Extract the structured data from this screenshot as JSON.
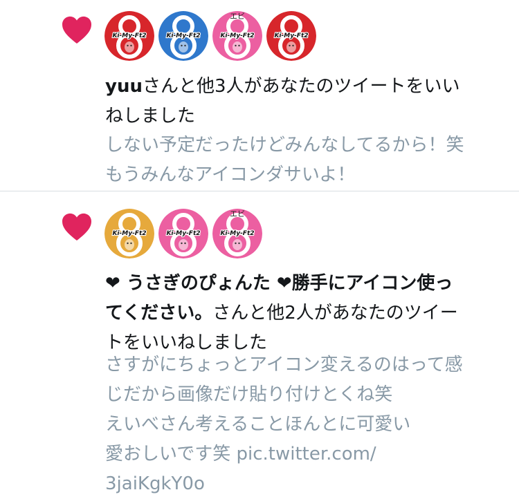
{
  "colors": {
    "heart": "#e0245e",
    "red": "#d7262b",
    "blue": "#2f78cc",
    "pink": "#ec5fa1",
    "yellow": "#e6a93c",
    "divider": "#d8dde1",
    "name_text": "#14171a",
    "preview_text": "#8899a6"
  },
  "notifications": [
    {
      "icon": "heart-icon",
      "avatars": [
        {
          "color": "red",
          "logo": "Ki-My-Ft2",
          "overlay": ""
        },
        {
          "color": "blue",
          "logo": "Ki-My-Ft2",
          "overlay": ""
        },
        {
          "color": "pink",
          "logo": "Ki-My-Ft2",
          "overlay": "エビ"
        },
        {
          "color": "red",
          "logo": "Ki-My-Ft2",
          "overlay": ""
        }
      ],
      "desc_name": "yuu",
      "desc_line1_rest": "さんと他3人があなたのツイートをいい",
      "desc_line2": "ねしました",
      "preview_lines": [
        "しない予定だったけどみんなしてるから！笑",
        "もうみんなアイコンダサいよ！"
      ]
    },
    {
      "icon": "heart-icon",
      "avatars": [
        {
          "color": "yellow",
          "logo": "Ki-My-Ft2",
          "overlay": ""
        },
        {
          "color": "pink",
          "logo": "Ki-My-Ft2",
          "overlay": ""
        },
        {
          "color": "pink",
          "logo": "Ki-My-Ft2",
          "overlay": "エビ"
        }
      ],
      "desc_line1": "❤ うさぎのぴょんた ❤勝手にアイコン使っ",
      "desc_line2_name": "てください。",
      "desc_line2_rest": "さんと他2人があなたのツイー",
      "desc_line3": "トをいいねしました",
      "preview_lines": [
        "さすがにちょっとアイコン変えるのはって感",
        "じだから画像だけ貼り付けとくね笑",
        "えいべさん考えることほんとに可愛い",
        "愛おしいです笑 pic.twitter.com/",
        "3jaiKgkY0o"
      ]
    }
  ]
}
